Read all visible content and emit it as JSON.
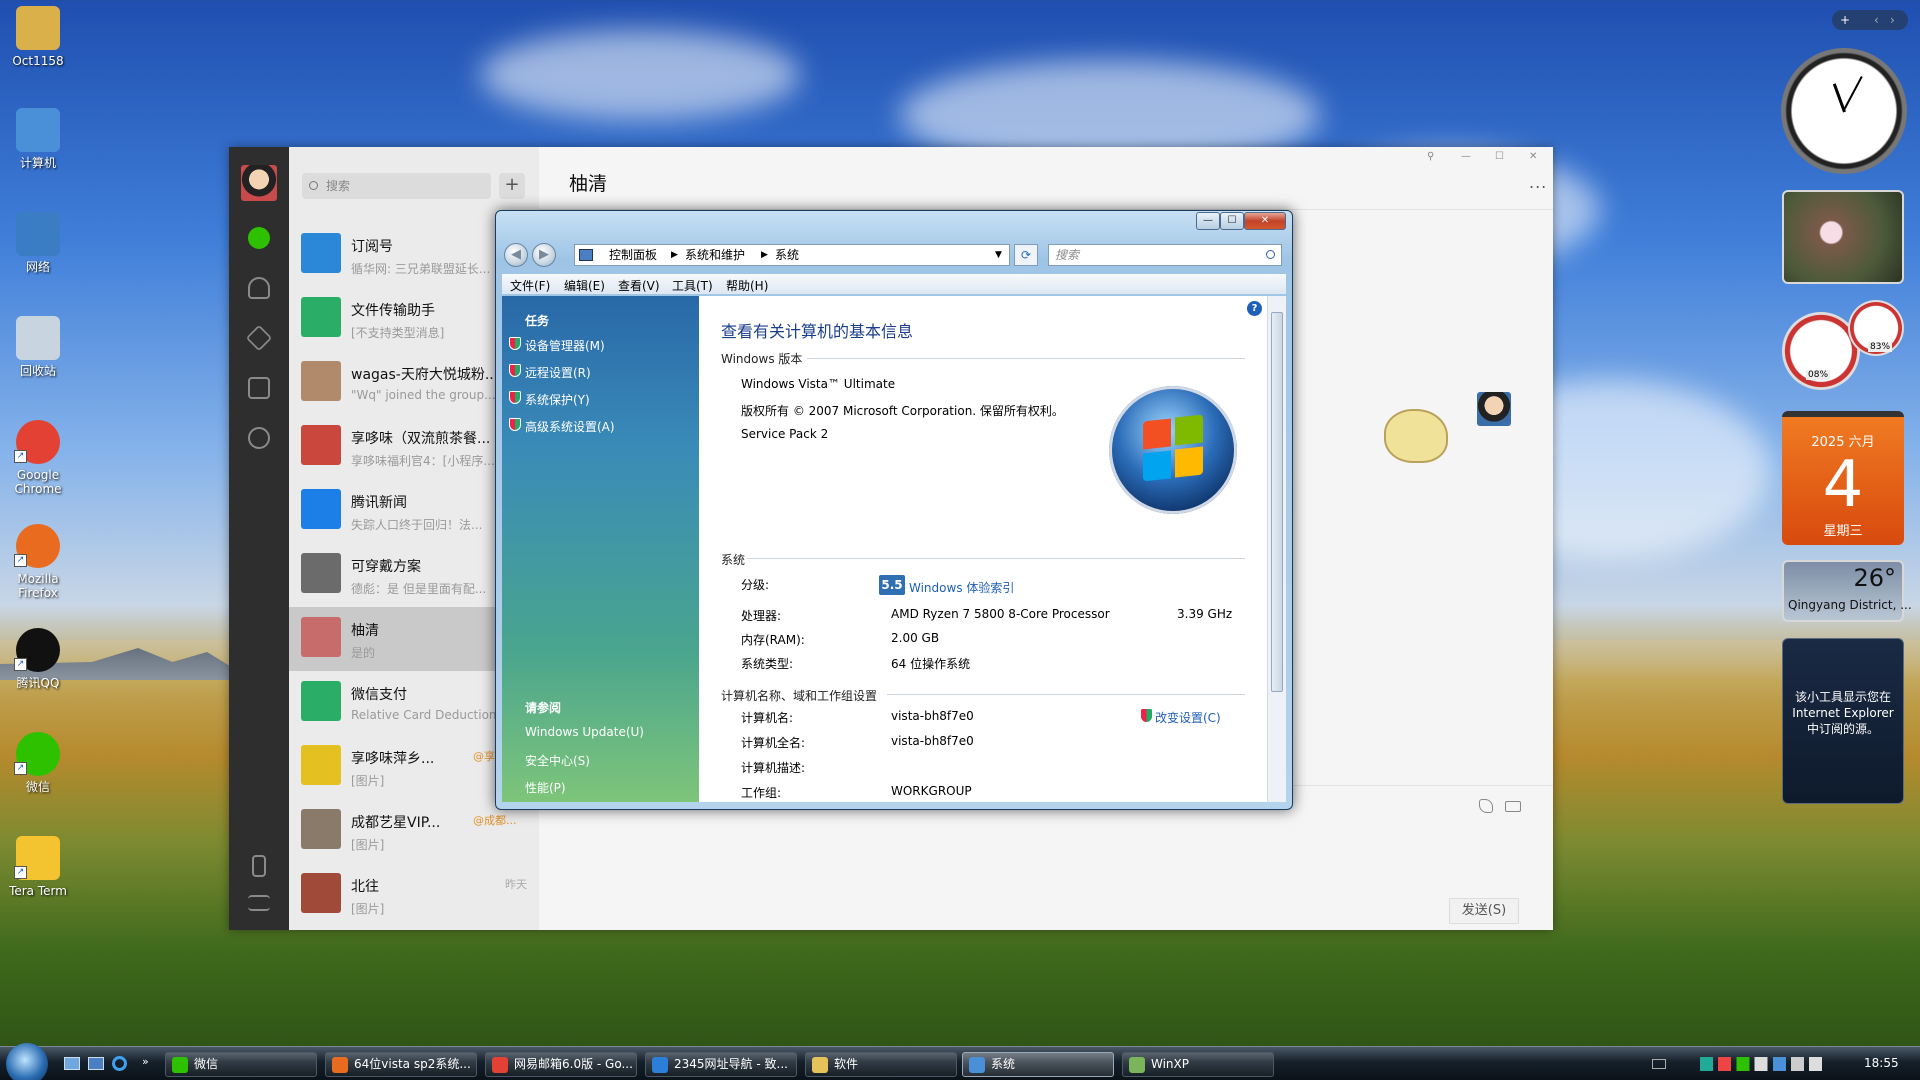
{
  "desktop": {
    "icons": [
      {
        "label": "Oct1158",
        "color": "#d9b04a"
      },
      {
        "label": "计算机",
        "color": "#4a90d9"
      },
      {
        "label": "网络",
        "color": "#3b7dc4"
      },
      {
        "label": "回收站",
        "color": "#c8d4e0"
      },
      {
        "label": "Google\nChrome",
        "color": "#e34133"
      },
      {
        "label": "Mozilla\nFirefox",
        "color": "#e86b1f"
      },
      {
        "label": "腾讯QQ",
        "color": "#111111"
      },
      {
        "label": "微信",
        "color": "#2dc100"
      },
      {
        "label": "Tera Term",
        "color": "#f4c430"
      }
    ]
  },
  "wechat": {
    "search_placeholder": "搜索",
    "plus": "+",
    "conversations": [
      {
        "name": "订阅号",
        "preview": "循华网: 三兄弟联盟延长...",
        "time": "",
        "color": "#2b88d8"
      },
      {
        "name": "文件传输助手",
        "preview": "[不支持类型消息]",
        "time": "",
        "color": "#2aae67"
      },
      {
        "name": "wagas-天府大悦城粉...",
        "preview": "\"Wq\" joined the group...",
        "time": "",
        "color": "#b08a6a"
      },
      {
        "name": "享哆味（双流煎茶餐...",
        "preview": "享哆味福利官4：[小程序...",
        "time": "",
        "color": "#c9473c"
      },
      {
        "name": "腾讯新闻",
        "preview": "失踪人口终于回归！法...",
        "time": "",
        "color": "#1c7fe8"
      },
      {
        "name": "可穿戴方案",
        "preview": "德彪：是  但是里面有配...",
        "time": "",
        "color": "#6b6b6b"
      },
      {
        "name": "柚清",
        "preview": "是的",
        "time": "",
        "color": "#c76b6b"
      },
      {
        "name": "微信支付",
        "preview": "Relative Card Deduction...",
        "time": "",
        "color": "#2aae67"
      },
      {
        "name": "享哆味萍乡...",
        "preview": "[图片]",
        "time": "",
        "tag": "@享哆味",
        "color": "#e4c021"
      },
      {
        "name": "成都艺星VIP...",
        "preview": "[图片]",
        "time": "",
        "tag": "@成都...",
        "color": "#8a7a6a"
      },
      {
        "name": "北往",
        "preview": "[图片]",
        "time": "昨天",
        "color": "#a04b3a"
      }
    ],
    "chat_title": "柚清",
    "more": "...",
    "send_label": "发送(S)",
    "window_controls": [
      "⚲",
      "—",
      "☐",
      "✕"
    ]
  },
  "vista": {
    "address": [
      "控制面板",
      "系统和维护",
      "系统"
    ],
    "search_placeholder": "搜索",
    "menu": [
      "文件(F)",
      "编辑(E)",
      "查看(V)",
      "工具(T)",
      "帮助(H)"
    ],
    "tasks_title": "任务",
    "tasks": [
      "设备管理器(M)",
      "远程设置(R)",
      "系统保护(Y)",
      "高级系统设置(A)"
    ],
    "see_also_title": "请参阅",
    "see_also": [
      "Windows Update(U)",
      "安全中心(S)",
      "性能(P)"
    ],
    "page_title": "查看有关计算机的基本信息",
    "edition_header": "Windows 版本",
    "edition": "Windows Vista™ Ultimate",
    "copyright": "版权所有 © 2007 Microsoft Corporation. 保留所有权利。",
    "service_pack": "Service Pack 2",
    "system_header": "系统",
    "rating_label": "分级:",
    "rating_score": "5.5",
    "rating_link": "Windows 体验索引",
    "cpu_label": "处理器:",
    "cpu_value": "AMD Ryzen 7 5800 8-Core Processor",
    "cpu_speed": "3.39 GHz",
    "ram_label": "内存(RAM):",
    "ram_value": "2.00 GB",
    "systype_label": "系统类型:",
    "systype_value": "64 位操作系统",
    "name_header": "计算机名称、域和工作组设置",
    "pcname_label": "计算机名:",
    "pcname_value": "vista-bh8f7e0",
    "fullname_label": "计算机全名:",
    "fullname_value": "vista-bh8f7e0",
    "desc_label": "计算机描述:",
    "workgroup_label": "工作组:",
    "workgroup_value": "WORKGROUP",
    "change_settings": "改变设置(C)",
    "btn_min": "—",
    "btn_max": "☐",
    "btn_close": "✕",
    "help": "?"
  },
  "gadgets": {
    "calendar_month": "2025 六月",
    "calendar_day": "4",
    "calendar_weekday": "星期三",
    "weather_temp": "26°",
    "weather_location": "Qingyang District, ...",
    "feed_text": "该小工具显示您在 Internet Explorer 中订阅的源。",
    "cpu_pct": "08%",
    "ram_pct": "83%"
  },
  "taskbar": {
    "items": [
      {
        "label": "微信",
        "color": "#2dc100"
      },
      {
        "label": "64位vista sp2系统...",
        "color": "#e86b1f"
      },
      {
        "label": "网易邮箱6.0版 - Go...",
        "color": "#e34133"
      },
      {
        "label": "2345网址导航 - 致...",
        "color": "#2b7fd8"
      },
      {
        "label": "软件",
        "color": "#e6c35a"
      },
      {
        "label": "系统",
        "color": "#4a90d9"
      },
      {
        "label": "WinXP",
        "color": "#7ab55c"
      }
    ],
    "clock": "18:55"
  }
}
